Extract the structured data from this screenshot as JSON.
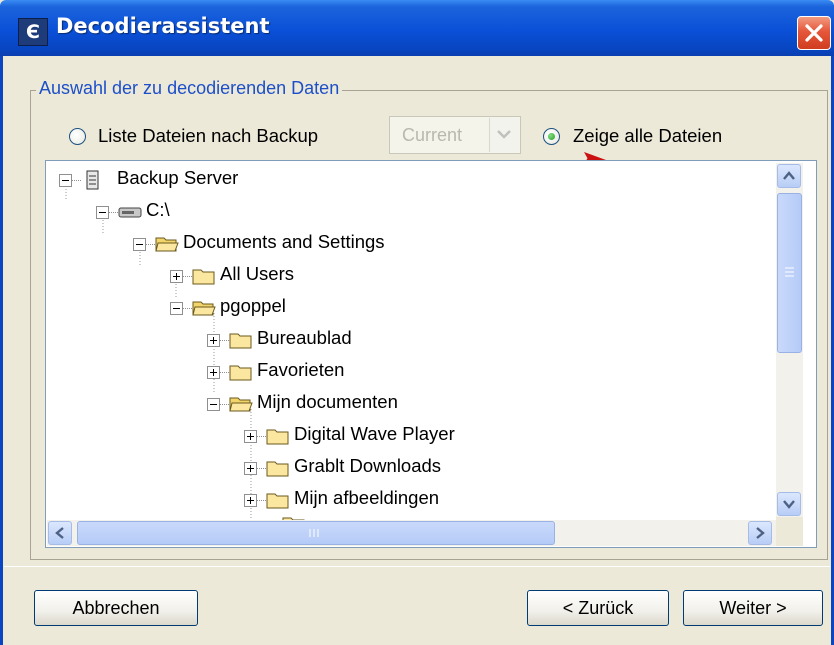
{
  "window": {
    "title": "Decodierassistent",
    "app_icon": "Є"
  },
  "group": {
    "title": "Auswahl der zu decodierenden Daten"
  },
  "options": {
    "backup_radio_label": "Liste Dateien nach Backup",
    "backup_select_value": "Current",
    "all_radio_label": "Zeige alle Dateien",
    "selected": "Zeige alle Dateien"
  },
  "tree": {
    "nodes": [
      {
        "label": "Backup Server",
        "icon": "server-icon",
        "toggle": "minus"
      },
      {
        "label": "C:\\",
        "icon": "drive-icon",
        "toggle": "minus"
      },
      {
        "label": "Documents and Settings",
        "icon": "open-folder-icon",
        "toggle": "minus"
      },
      {
        "label": "All Users",
        "icon": "folder-icon",
        "toggle": "plus"
      },
      {
        "label": "pgoppel",
        "icon": "open-folder-icon",
        "toggle": "minus"
      },
      {
        "label": "Bureaublad",
        "icon": "folder-icon",
        "toggle": "plus"
      },
      {
        "label": "Favorieten",
        "icon": "folder-icon",
        "toggle": "plus"
      },
      {
        "label": "Mijn documenten",
        "icon": "open-folder-icon",
        "toggle": "minus"
      },
      {
        "label": "Digital Wave Player",
        "icon": "folder-icon",
        "toggle": "plus"
      },
      {
        "label": "Grablt Downloads",
        "icon": "folder-icon",
        "toggle": "plus"
      },
      {
        "label": "Mijn afbeeldingen",
        "icon": "folder-icon",
        "toggle": "plus"
      }
    ]
  },
  "buttons": {
    "cancel": "Abbrechen",
    "back": "< Zurück",
    "next": "Weiter >"
  },
  "colors": {
    "titlebar": "#0a50d8",
    "legend_text": "#1d4fc9",
    "window_bg": "#ece9d8",
    "annotation_arrow": "#cc1111"
  }
}
